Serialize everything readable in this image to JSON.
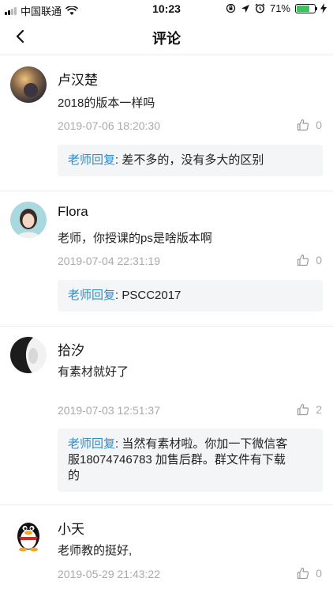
{
  "status": {
    "carrier": "中国联通",
    "time": "10:23",
    "battery": "71%",
    "battery_level": 0.71
  },
  "nav": {
    "title": "评论",
    "back_icon": "chevron-left-icon"
  },
  "reply_label": "老师回复",
  "comments": [
    {
      "name": "卢汉楚",
      "text": "2018的版本一样吗",
      "time": "2019-07-06 18:20:30",
      "likes": "0",
      "reply": "差不多的，没有多大的区别"
    },
    {
      "name": "Flora",
      "text": "老师，你授课的ps是啥版本啊",
      "time": "2019-07-04 22:31:19",
      "likes": "0",
      "reply": "PSCC2017"
    },
    {
      "name": "拾汐",
      "text": "有素材就好了",
      "time": "2019-07-03 12:51:37",
      "likes": "2",
      "reply_line1": "当然有素材啦。你加一下微信客",
      "reply_line2": "服18074746783 加售后群。群文件有下载",
      "reply_line3": "的"
    },
    {
      "name": "小天",
      "text": "老师教的挺好,",
      "time": "2019-05-29 21:43:22",
      "likes": "0"
    }
  ],
  "colors": {
    "accent": "#2c8ccc",
    "reply_bg": "#f4f5f7",
    "meta": "#aaaaaa"
  }
}
